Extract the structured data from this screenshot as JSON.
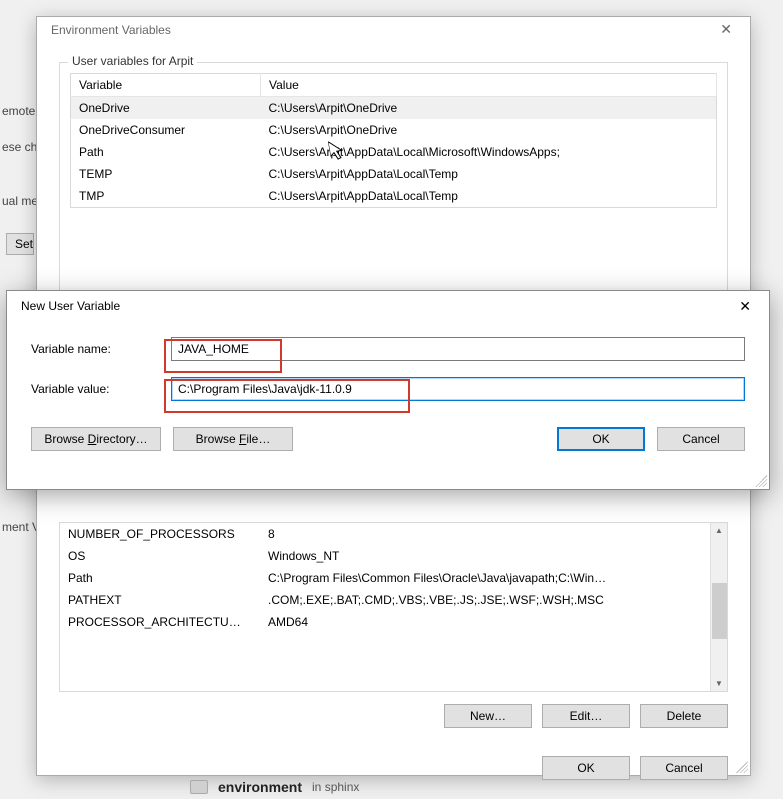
{
  "bg": {
    "label_remote": "emote",
    "label_ese": "ese ch",
    "label_ual": "ual me",
    "btn_set": "Set",
    "label_mentv": "ment V"
  },
  "env": {
    "title": "Environment Variables",
    "user_group": "User variables for Arpit",
    "col_variable": "Variable",
    "col_value": "Value",
    "user_rows": [
      {
        "variable": "OneDrive",
        "value": "C:\\Users\\Arpit\\OneDrive"
      },
      {
        "variable": "OneDriveConsumer",
        "value": "C:\\Users\\Arpit\\OneDrive"
      },
      {
        "variable": "Path",
        "value": "C:\\Users\\Arpit\\AppData\\Local\\Microsoft\\WindowsApps;"
      },
      {
        "variable": "TEMP",
        "value": "C:\\Users\\Arpit\\AppData\\Local\\Temp"
      },
      {
        "variable": "TMP",
        "value": "C:\\Users\\Arpit\\AppData\\Local\\Temp"
      }
    ],
    "sys_rows": [
      {
        "variable": "NUMBER_OF_PROCESSORS",
        "value": "8"
      },
      {
        "variable": "OS",
        "value": "Windows_NT"
      },
      {
        "variable": "Path",
        "value": "C:\\Program Files\\Common Files\\Oracle\\Java\\javapath;C:\\Win…"
      },
      {
        "variable": "PATHEXT",
        "value": ".COM;.EXE;.BAT;.CMD;.VBS;.VBE;.JS;.JSE;.WSF;.WSH;.MSC"
      },
      {
        "variable": "PROCESSOR_ARCHITECTU…",
        "value": "AMD64"
      }
    ],
    "btn_new": "New…",
    "btn_edit": "Edit…",
    "btn_delete": "Delete",
    "btn_ok": "OK",
    "btn_cancel": "Cancel"
  },
  "modal": {
    "title": "New User Variable",
    "label_name": "Variable name:",
    "label_value": "Variable value:",
    "value_name": "JAVA_HOME",
    "value_value": "C:\\Program Files\\Java\\jdk-11.0.9",
    "btn_browse_dir": "Browse Directory…",
    "btn_browse_file": "Browse File…",
    "btn_ok": "OK",
    "btn_cancel": "Cancel"
  },
  "footer": {
    "title": "environment",
    "sub": "in sphinx"
  }
}
